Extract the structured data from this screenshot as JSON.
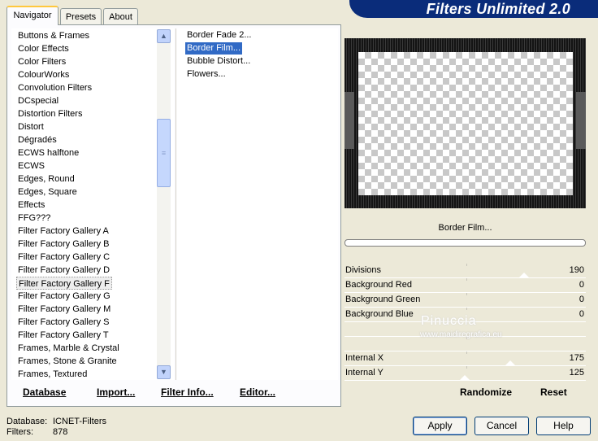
{
  "banner": {
    "title": "Filters Unlimited 2.0"
  },
  "tabs": [
    {
      "label": "Navigator",
      "active": true
    },
    {
      "label": "Presets",
      "active": false
    },
    {
      "label": "About",
      "active": false
    }
  ],
  "categories": {
    "items": [
      "Buttons & Frames",
      "Color Effects",
      "Color Filters",
      "ColourWorks",
      "Convolution Filters",
      "DCspecial",
      "Distortion Filters",
      "Distort",
      "Dégradés",
      "ECWS halftone",
      "ECWS",
      "Edges, Round",
      "Edges, Square",
      "Effects",
      "FFG???",
      "Filter Factory Gallery A",
      "Filter Factory Gallery B",
      "Filter Factory Gallery C",
      "Filter Factory Gallery D",
      "Filter Factory Gallery F",
      "Filter Factory Gallery G",
      "Filter Factory Gallery M",
      "Filter Factory Gallery S",
      "Filter Factory Gallery T",
      "Frames, Marble & Crystal",
      "Frames, Stone & Granite",
      "Frames, Textured"
    ],
    "selected_index": 19
  },
  "filters": {
    "items": [
      "Border Fade 2...",
      "Border Film...",
      "Bubble Distort...",
      "Flowers..."
    ],
    "selected_index": 1
  },
  "nav_buttons": {
    "database": "Database",
    "import": "Import...",
    "filter_info": "Filter Info...",
    "editor": "Editor..."
  },
  "preview": {
    "filter_name": "Border Film...",
    "progress": 0
  },
  "params": [
    {
      "label": "Divisions",
      "value": "190"
    },
    {
      "label": "Background Red",
      "value": "0"
    },
    {
      "label": "Background Green",
      "value": "0"
    },
    {
      "label": "Background Blue",
      "value": "0"
    },
    {
      "label": "",
      "value": ""
    },
    {
      "label": "",
      "value": ""
    },
    {
      "label": "Internal X",
      "value": "175"
    },
    {
      "label": "Internal Y",
      "value": "125"
    }
  ],
  "watermark": {
    "name": "Pinuccia",
    "site": "www.maidiregrafica.eu"
  },
  "actions": {
    "randomize": "Randomize",
    "reset": "Reset"
  },
  "status": {
    "database_label": "Database:",
    "database_value": "ICNET-Filters",
    "filters_label": "Filters:",
    "filters_value": "878"
  },
  "dialog_buttons": {
    "apply": "Apply",
    "cancel": "Cancel",
    "help": "Help"
  },
  "icons": {
    "scroll_up": "▲",
    "scroll_down": "▼",
    "thumb_grip": "≡"
  },
  "colors": {
    "banner": "#0a2c7a",
    "selection": "#316ac5",
    "dialog_bg": "#ece9d8"
  }
}
